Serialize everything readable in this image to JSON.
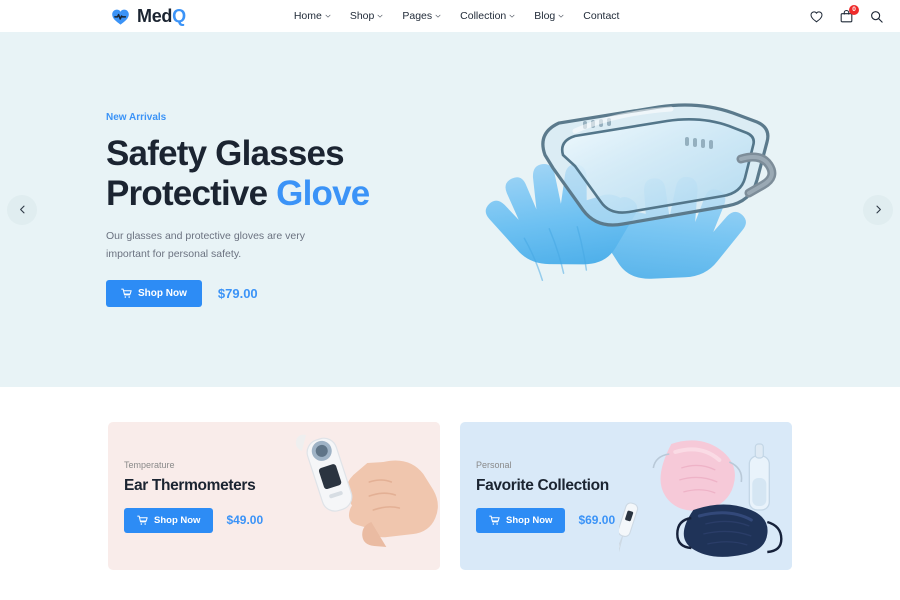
{
  "header": {
    "brand": {
      "name_dark": "Med",
      "name_accent": "Q",
      "logo_icon": "heart-pulse-icon"
    },
    "nav": [
      {
        "label": "Home",
        "has_caret": true
      },
      {
        "label": "Shop",
        "has_caret": true
      },
      {
        "label": "Pages",
        "has_caret": true
      },
      {
        "label": "Collection",
        "has_caret": true
      },
      {
        "label": "Blog",
        "has_caret": true
      },
      {
        "label": "Contact",
        "has_caret": false
      }
    ],
    "actions": {
      "wishlist_icon": "heart-icon",
      "cart_icon": "shopping-bag-icon",
      "cart_count": "0",
      "search_icon": "search-icon"
    }
  },
  "hero": {
    "eyebrow": "New Arrivals",
    "title_line1": "Safety Glasses",
    "title_line2_dark": "Protective ",
    "title_line2_accent": "Glove",
    "description": "Our glasses and protective gloves are very important for personal safety.",
    "cta_label": "Shop Now",
    "cta_icon": "cart-icon",
    "price": "$79.00",
    "prev_icon": "chevron-left-icon",
    "next_icon": "chevron-right-icon",
    "image_alt": "safety-goggles-on-blue-gloves"
  },
  "promos": [
    {
      "label": "Temperature",
      "title": "Ear Thermometers",
      "cta_label": "Shop Now",
      "cta_icon": "cart-icon",
      "price": "$49.00",
      "image_alt": "hand-holding-ear-thermometer"
    },
    {
      "label": "Personal",
      "title": "Favorite Collection",
      "cta_label": "Shop Now",
      "cta_icon": "cart-icon",
      "price": "$69.00",
      "image_alt": "masks-sanitizer-thermometer-flatlay"
    }
  ],
  "colors": {
    "accent_blue": "#3b93f7",
    "button_blue": "#2d8cf5",
    "dark_navy": "#1b2431",
    "hero_bg": "#e8f3f6",
    "promo_pink_bg": "#f9ecea",
    "promo_blue_bg": "#d9e9f8",
    "badge_red": "#ef2b2b"
  }
}
